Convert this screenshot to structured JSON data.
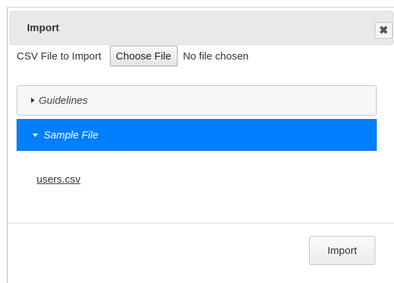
{
  "dialog": {
    "title": "Import",
    "close_label": "✖"
  },
  "file_input": {
    "label": "CSV File to Import",
    "button_label": "Choose File",
    "status": "No file chosen"
  },
  "accordion": {
    "sections": [
      {
        "label": "Guidelines",
        "expanded": false
      },
      {
        "label": "Sample File",
        "expanded": true,
        "link_text": "users.csv"
      }
    ]
  },
  "footer": {
    "import_label": "Import"
  },
  "colors": {
    "active_header": "#007fff",
    "titlebar": "#e9e9e9"
  }
}
